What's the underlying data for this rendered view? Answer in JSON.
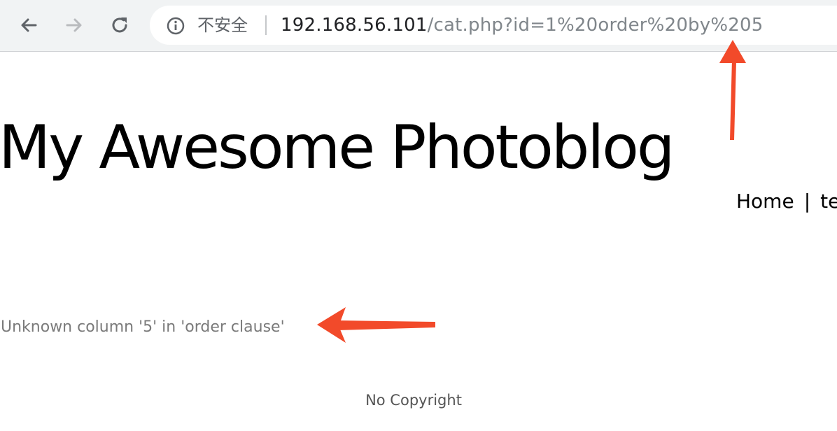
{
  "browser": {
    "security_label": "不安全",
    "url_host": "192.168.56.101",
    "url_path": "/cat.php?id=1%20order%20by%205",
    "icons": [
      "back-arrow-icon",
      "forward-arrow-icon",
      "reload-icon",
      "info-icon"
    ]
  },
  "page": {
    "site_title": "My Awesome Photoblog",
    "nav": {
      "home": "Home",
      "separator": "|",
      "next": "te"
    },
    "error_message": "Unknown column '5' in 'order clause'",
    "footer": "No Copyright"
  },
  "colors": {
    "annotation_arrow": "#f24a2a",
    "toolbar_bg": "#f1f3f4"
  }
}
